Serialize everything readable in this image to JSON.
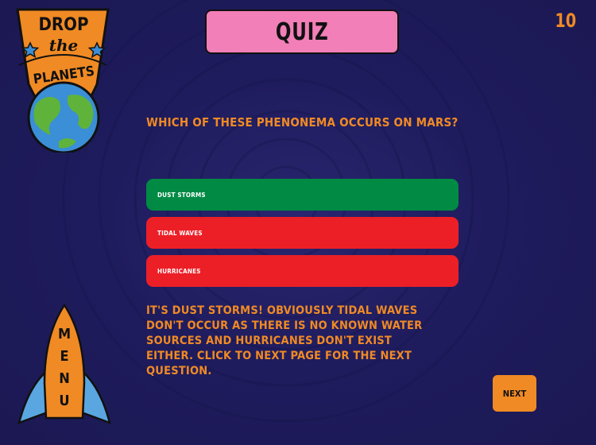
{
  "logo": {
    "line1": "DROP",
    "line2": "the",
    "line3": "PLANETS"
  },
  "header": {
    "title": "QUIZ",
    "counter": "10"
  },
  "question": {
    "text": "WHICH OF THESE PHENONEMA OCCURS ON MARS?"
  },
  "answers": [
    {
      "label": "DUST STORMS",
      "state": "correct",
      "color": "#008a44"
    },
    {
      "label": "TIDAL WAVES",
      "state": "incorrect",
      "color": "#ec1f27"
    },
    {
      "label": "HURRICANES",
      "state": "incorrect",
      "color": "#ec1f27"
    }
  ],
  "explanation": {
    "text": "IT'S DUST STORMS! OBVIOUSLY TIDAL WAVES DON'T OCCUR AS THERE IS NO KNOWN WATER SOURCES AND HURRICANES DON'T EXIST EITHER. CLICK TO NEXT PAGE FOR THE NEXT QUESTION."
  },
  "next_button": {
    "label": "NEXT"
  },
  "menu": {
    "label": "MENU",
    "letters": [
      "M",
      "E",
      "N",
      "U"
    ]
  },
  "colors": {
    "background": "#1f1c5e",
    "accent_orange": "#f08a24",
    "title_pink": "#f27fb7",
    "correct_green": "#008a44",
    "incorrect_red": "#ec1f27",
    "planet_blue": "#3a8fd6",
    "planet_green": "#5fb33b"
  }
}
